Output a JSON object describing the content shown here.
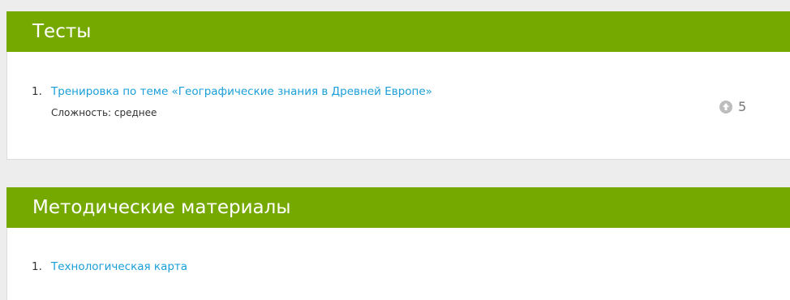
{
  "tests": {
    "title": "Тесты",
    "items": [
      {
        "number": "1.",
        "title": "Тренировка по теме «Географические знания в Древней Европе»",
        "difficulty": "Сложность: среднее",
        "score": "5"
      }
    ]
  },
  "methods": {
    "title": "Методические материалы",
    "items": [
      {
        "number": "1.",
        "title": "Технологическая карта"
      }
    ]
  },
  "colors": {
    "header_bg": "#76a900",
    "link": "#1a9ed9",
    "page_bg": "#ededed"
  },
  "icons": {
    "score": "score-arrow-icon"
  }
}
